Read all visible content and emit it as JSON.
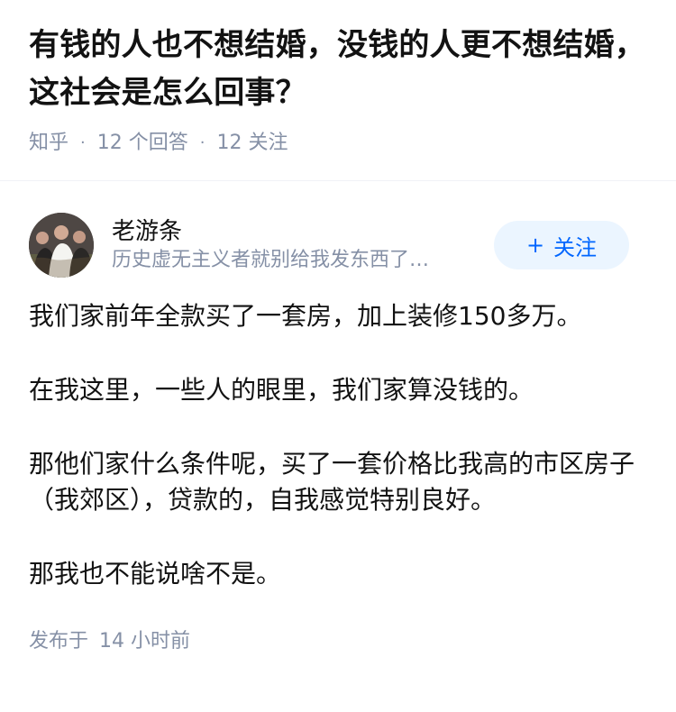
{
  "question": {
    "title": "有钱的人也不想结婚，没钱的人更不想结婚，这社会是怎么回事？",
    "source": "知乎",
    "answer_count": "12 个回答",
    "follow_count": "12 关注"
  },
  "author": {
    "name": "老游条",
    "bio": "历史虚无主义者就别给我发东西了…",
    "follow_label": "关注",
    "follow_icon": "plus-icon"
  },
  "answer": {
    "paragraphs": [
      "我们家前年全款买了一套房，加上装修150多万。",
      "在我这里，一些人的眼里，我们家算没钱的。",
      "那他们家什么条件呢，买了一套价格比我高的市区房子（我郊区），贷款的，自我感觉特别良好。",
      "那我也不能说啥不是。"
    ],
    "published_prefix": "发布于",
    "published_time": "14 小时前"
  },
  "colors": {
    "title": "#121212",
    "meta": "#8590a6",
    "follow_bg": "#ebf5ff",
    "follow_text": "#0066ff"
  }
}
